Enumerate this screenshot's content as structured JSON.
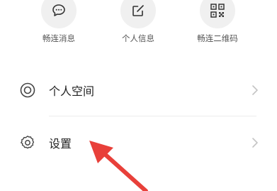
{
  "quick_actions": [
    {
      "label": "畅连消息",
      "icon": "message-icon"
    },
    {
      "label": "个人信息",
      "icon": "edit-icon"
    },
    {
      "label": "畅连二维码",
      "icon": "qrcode-icon"
    }
  ],
  "menu": [
    {
      "label": "个人空间",
      "icon": "ring-icon"
    },
    {
      "label": "设置",
      "icon": "gear-icon"
    }
  ],
  "annotation": {
    "color": "#e8403a"
  }
}
